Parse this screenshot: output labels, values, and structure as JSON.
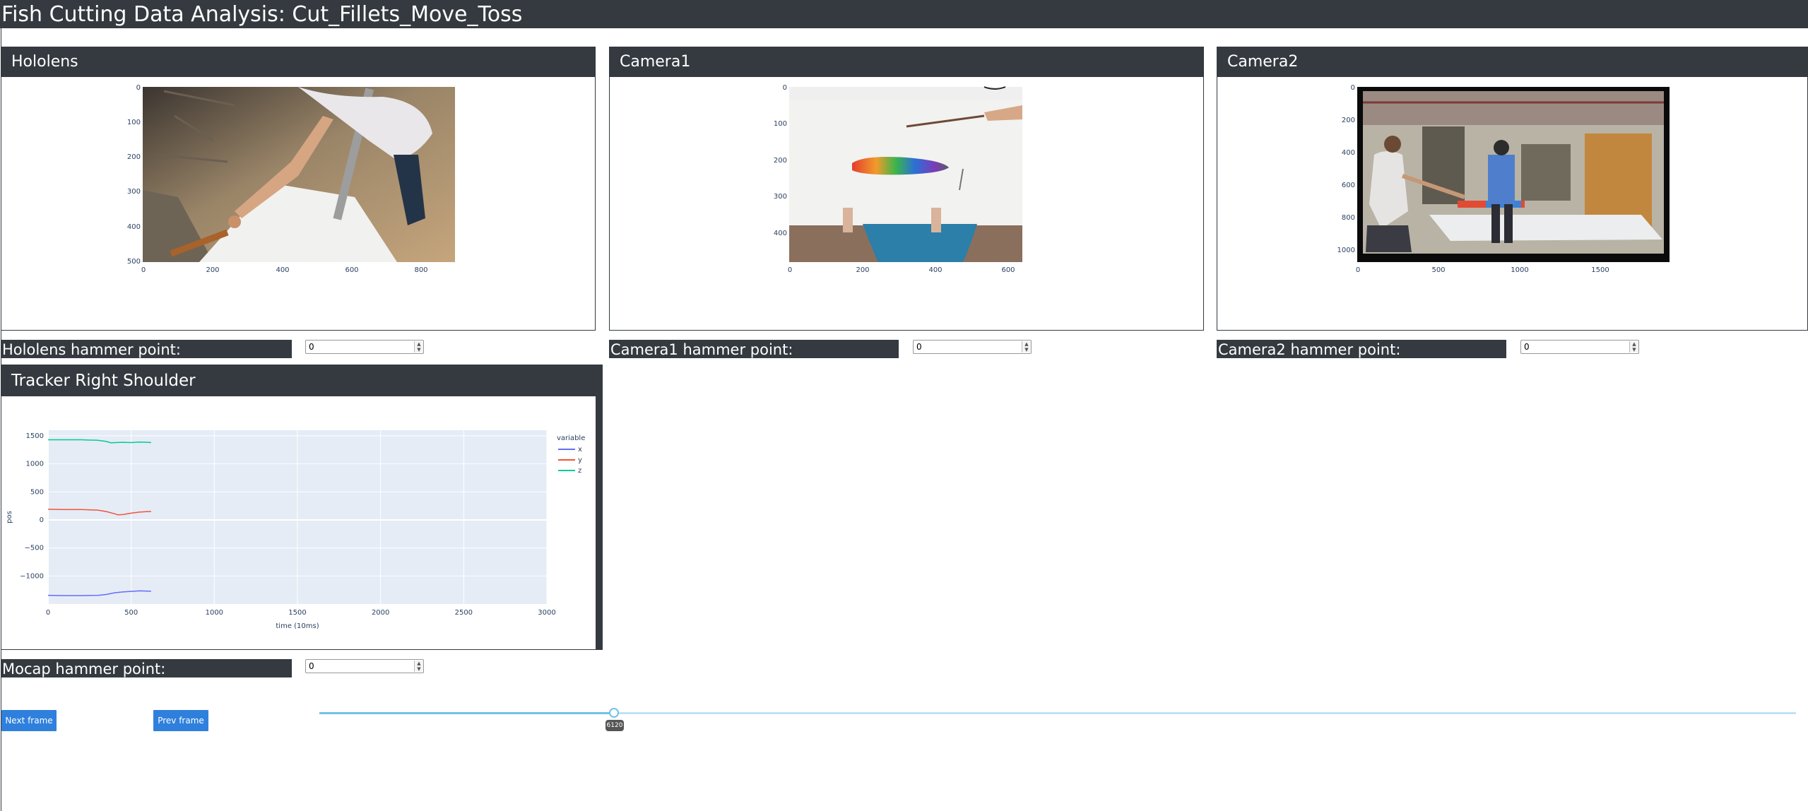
{
  "app_title": "Fish Cutting Data Analysis: Cut_Fillets_Move_Toss",
  "panels": {
    "hololens": {
      "title": "Hololens",
      "x_ticks": [
        "0",
        "200",
        "400",
        "600",
        "800"
      ],
      "y_ticks": [
        "0",
        "100",
        "200",
        "300",
        "400",
        "500"
      ]
    },
    "camera1": {
      "title": "Camera1",
      "x_ticks": [
        "0",
        "200",
        "400",
        "600"
      ],
      "y_ticks": [
        "0",
        "100",
        "200",
        "300",
        "400"
      ]
    },
    "camera2": {
      "title": "Camera2",
      "x_ticks": [
        "0",
        "500",
        "1000",
        "1500"
      ],
      "y_ticks": [
        "0",
        "200",
        "400",
        "600",
        "800",
        "1000"
      ]
    }
  },
  "hammer_points": {
    "hololens": {
      "label": "Hololens hammer point:",
      "value": "0"
    },
    "camera1": {
      "label": "Camera1 hammer point:",
      "value": "0"
    },
    "camera2": {
      "label": "Camera2 hammer point:",
      "value": "0"
    },
    "mocap": {
      "label": "Mocap hammer point:",
      "value": "0"
    }
  },
  "tracker": {
    "title": "Tracker Right Shoulder"
  },
  "buttons": {
    "next": "Next frame",
    "prev": "Prev frame"
  },
  "slider": {
    "value": "6120",
    "fraction": 0.2
  },
  "chart_data": {
    "type": "line",
    "title": "",
    "xlabel": "time (10ms)",
    "ylabel": "pos",
    "xlim": [
      0,
      3000
    ],
    "ylim": [
      -1500,
      1600
    ],
    "x_ticks": [
      0,
      500,
      1000,
      1500,
      2000,
      2500,
      3000
    ],
    "y_ticks": [
      1500,
      1000,
      500,
      0,
      -500,
      -1000
    ],
    "y_tick_labels": [
      "1500",
      "1000",
      "500",
      "0",
      "−1000",
      "−500"
    ],
    "grid": true,
    "legend_title": "variable",
    "legend_position": "right",
    "series": [
      {
        "name": "x",
        "color": "#636efa",
        "x": [
          0,
          100,
          200,
          300,
          350,
          400,
          450,
          500,
          550,
          600,
          620
        ],
        "y": [
          -1345,
          -1350,
          -1350,
          -1345,
          -1330,
          -1300,
          -1285,
          -1275,
          -1265,
          -1270,
          -1272
        ]
      },
      {
        "name": "y",
        "color": "#ef553b",
        "x": [
          0,
          100,
          200,
          300,
          350,
          400,
          420,
          450,
          500,
          550,
          600,
          620
        ],
        "y": [
          190,
          185,
          185,
          175,
          150,
          110,
          90,
          95,
          120,
          140,
          150,
          150
        ]
      },
      {
        "name": "z",
        "color": "#00cc96",
        "x": [
          0,
          100,
          200,
          300,
          350,
          380,
          400,
          450,
          500,
          550,
          600,
          620
        ],
        "y": [
          1430,
          1430,
          1430,
          1420,
          1400,
          1375,
          1380,
          1385,
          1380,
          1390,
          1385,
          1380
        ]
      }
    ]
  },
  "colors": {
    "header_bg": "#343a40",
    "button_blue": "#2f80dd",
    "plot_bg": "#e5ecf6",
    "slider": "#6fc3e8"
  }
}
